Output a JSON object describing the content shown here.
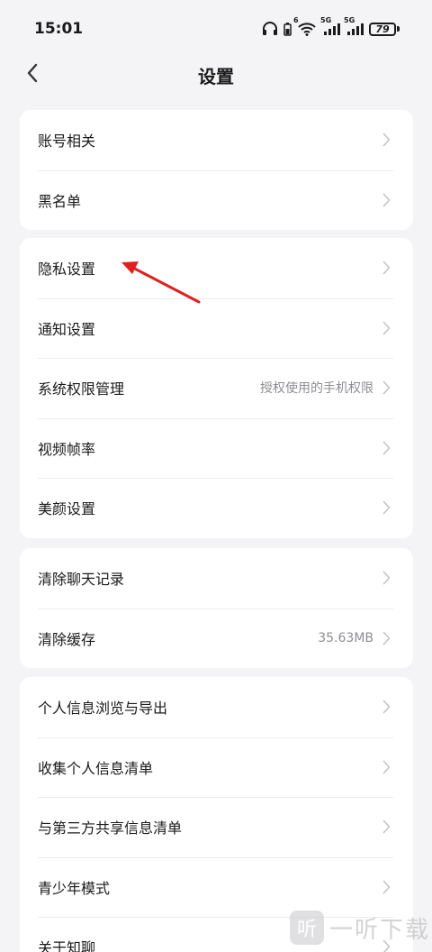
{
  "status_bar": {
    "time": "15:01",
    "network_5g_a": "5G",
    "network_5g_b": "5G",
    "wifi_badge": "6",
    "battery": "79"
  },
  "header": {
    "title": "设置",
    "back_icon": "chevron-left-icon"
  },
  "groups": [
    {
      "items": [
        {
          "label": "账号相关",
          "value": ""
        },
        {
          "label": "黑名单",
          "value": ""
        }
      ]
    },
    {
      "items": [
        {
          "label": "隐私设置",
          "value": ""
        },
        {
          "label": "通知设置",
          "value": ""
        },
        {
          "label": "系统权限管理",
          "value": "授权使用的手机权限"
        },
        {
          "label": "视频帧率",
          "value": ""
        },
        {
          "label": "美颜设置",
          "value": ""
        }
      ]
    },
    {
      "items": [
        {
          "label": "清除聊天记录",
          "value": ""
        },
        {
          "label": "清除缓存",
          "value": "35.63MB"
        }
      ]
    },
    {
      "items": [
        {
          "label": "个人信息浏览与导出",
          "value": ""
        },
        {
          "label": "收集个人信息清单",
          "value": ""
        },
        {
          "label": "与第三方共享信息清单",
          "value": ""
        },
        {
          "label": "青少年模式",
          "value": ""
        },
        {
          "label": "关于知聊",
          "value": ""
        }
      ]
    }
  ],
  "annotation_color": "#e02020",
  "watermark": {
    "logo": "听",
    "text": "一听下载"
  }
}
